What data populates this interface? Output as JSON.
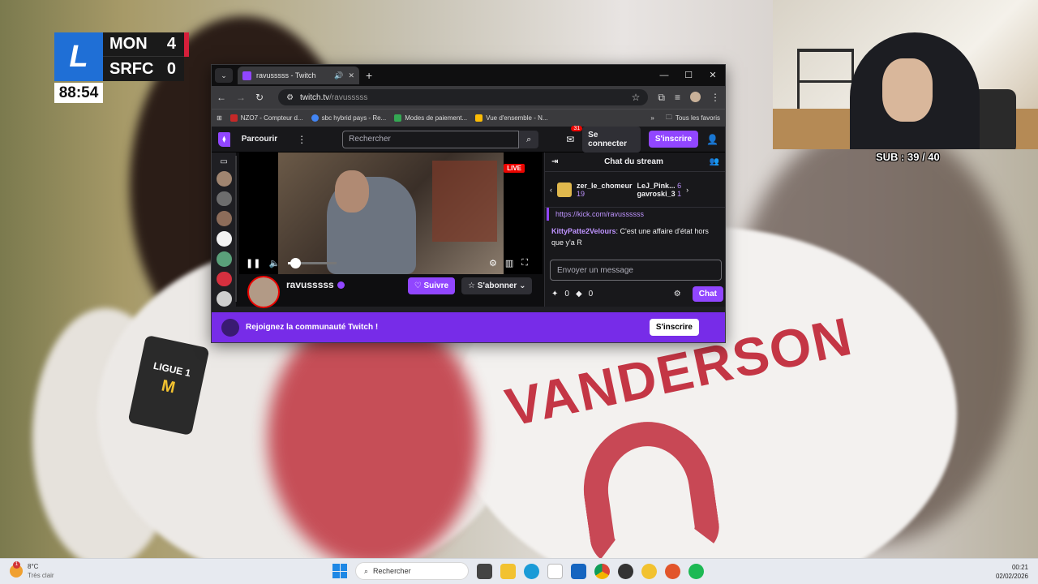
{
  "scoreboard": {
    "league_logo": "L1",
    "team1": "MON",
    "score1": "4",
    "team2": "SRFC",
    "score2": "0",
    "clock": "88:54"
  },
  "overlay": {
    "sub_counter": "SUB : 39 / 40"
  },
  "scene": {
    "jersey_name": "VANDERSON",
    "patch_text": "LIGUE 1"
  },
  "browser": {
    "tab_title": "ravusssss - Twitch",
    "url_host": "twitch.tv",
    "url_path": "/ravusssss",
    "bookmarks": [
      {
        "label": "NZO7 - Compteur d...",
        "color": "#c62828"
      },
      {
        "label": "sbc hybrid pays - Re...",
        "color": "#4285f4"
      },
      {
        "label": "Modes de paiement...",
        "color": "#34a853"
      },
      {
        "label": "Vue d'ensemble - N...",
        "color": "#fbbc05"
      }
    ],
    "all_bookmarks": "Tous les favoris"
  },
  "twitch": {
    "browse": "Parcourir",
    "search_placeholder": "Rechercher",
    "notif_count": "31",
    "login": "Se connecter",
    "signup": "S'inscrire",
    "live": "LIVE",
    "channel_name": "ravusssss",
    "follow": "Suivre",
    "subscribe": "S'abonner",
    "volume_level": 0.15,
    "chat": {
      "title": "Chat du stream",
      "gifters": [
        {
          "name": "zer_le_chomeur",
          "count": "19"
        },
        {
          "name": "LeJ_Pink...",
          "count": "6"
        },
        {
          "name": "gavroski_3",
          "count": "1"
        }
      ],
      "link": "https://kick.com/ravussssss",
      "message_user": "KittyPatte2Velours",
      "message_text": ": C'est une affaire d'état hors que y'a R",
      "input_placeholder": "Envoyer un message",
      "points1": "0",
      "points2": "0",
      "send": "Chat"
    },
    "banner_text": "Rejoignez la communauté Twitch !",
    "banner_button": "S'inscrire"
  },
  "taskbar": {
    "temp": "8°C",
    "condition": "Très clair",
    "search": "Rechercher",
    "time": "00:21",
    "date": "02/02/2026"
  }
}
